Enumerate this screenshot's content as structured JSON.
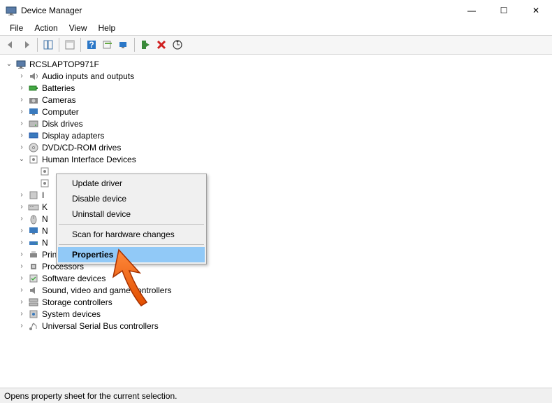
{
  "window": {
    "title": "Device Manager",
    "minimize": "—",
    "maximize": "☐",
    "close": "✕"
  },
  "menubar": [
    "File",
    "Action",
    "View",
    "Help"
  ],
  "root_node": "RCSLAPTOP971F",
  "categories": [
    {
      "label": "Audio inputs and outputs",
      "exp": "closed",
      "icon": "speaker"
    },
    {
      "label": "Batteries",
      "exp": "closed",
      "icon": "battery"
    },
    {
      "label": "Cameras",
      "exp": "closed",
      "icon": "camera"
    },
    {
      "label": "Computer",
      "exp": "closed",
      "icon": "monitor"
    },
    {
      "label": "Disk drives",
      "exp": "closed",
      "icon": "disk"
    },
    {
      "label": "Display adapters",
      "exp": "closed",
      "icon": "display"
    },
    {
      "label": "DVD/CD-ROM drives",
      "exp": "closed",
      "icon": "cd"
    },
    {
      "label": "Human Interface Devices",
      "exp": "open",
      "icon": "hid"
    },
    {
      "label": "I",
      "exp": "closed",
      "icon": "generic"
    },
    {
      "label": "K",
      "exp": "closed",
      "icon": "keyboard"
    },
    {
      "label": "N",
      "exp": "closed",
      "icon": "mouse"
    },
    {
      "label": "N",
      "exp": "closed",
      "icon": "monitor"
    },
    {
      "label": "N",
      "exp": "closed",
      "icon": "network"
    },
    {
      "label": "Print queues",
      "exp": "closed",
      "icon": "printer"
    },
    {
      "label": "Processors",
      "exp": "closed",
      "icon": "cpu"
    },
    {
      "label": "Software devices",
      "exp": "closed",
      "icon": "software"
    },
    {
      "label": "Sound, video and game controllers",
      "exp": "closed",
      "icon": "sound"
    },
    {
      "label": "Storage controllers",
      "exp": "closed",
      "icon": "storage"
    },
    {
      "label": "System devices",
      "exp": "closed",
      "icon": "system"
    },
    {
      "label": "Universal Serial Bus controllers",
      "exp": "closed",
      "icon": "usb"
    }
  ],
  "context_menu": {
    "items": [
      {
        "label": "Update driver"
      },
      {
        "label": "Disable device"
      },
      {
        "label": "Uninstall device"
      },
      {
        "sep": true
      },
      {
        "label": "Scan for hardware changes"
      },
      {
        "sep": true
      },
      {
        "label": "Properties",
        "selected": true
      }
    ]
  },
  "statusbar": "Opens property sheet for the current selection."
}
